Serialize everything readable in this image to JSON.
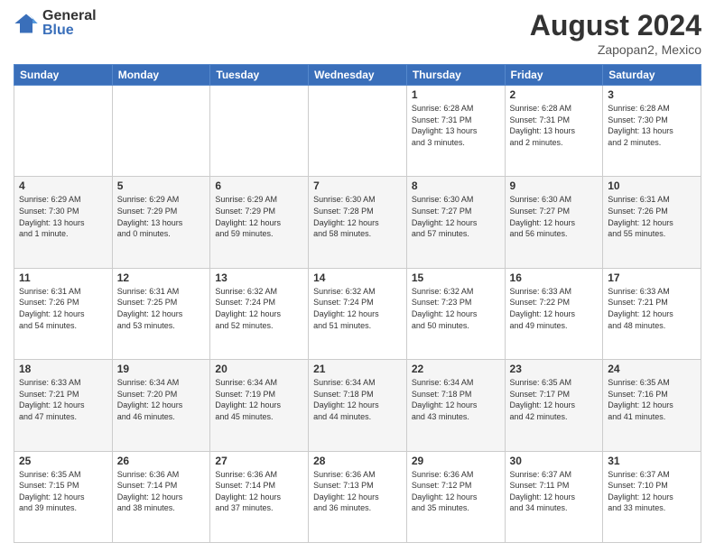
{
  "header": {
    "logo_general": "General",
    "logo_blue": "Blue",
    "month_year": "August 2024",
    "location": "Zapopan2, Mexico"
  },
  "days_of_week": [
    "Sunday",
    "Monday",
    "Tuesday",
    "Wednesday",
    "Thursday",
    "Friday",
    "Saturday"
  ],
  "weeks": [
    [
      {
        "day": "",
        "info": ""
      },
      {
        "day": "",
        "info": ""
      },
      {
        "day": "",
        "info": ""
      },
      {
        "day": "",
        "info": ""
      },
      {
        "day": "1",
        "info": "Sunrise: 6:28 AM\nSunset: 7:31 PM\nDaylight: 13 hours\nand 3 minutes."
      },
      {
        "day": "2",
        "info": "Sunrise: 6:28 AM\nSunset: 7:31 PM\nDaylight: 13 hours\nand 2 minutes."
      },
      {
        "day": "3",
        "info": "Sunrise: 6:28 AM\nSunset: 7:30 PM\nDaylight: 13 hours\nand 2 minutes."
      }
    ],
    [
      {
        "day": "4",
        "info": "Sunrise: 6:29 AM\nSunset: 7:30 PM\nDaylight: 13 hours\nand 1 minute."
      },
      {
        "day": "5",
        "info": "Sunrise: 6:29 AM\nSunset: 7:29 PM\nDaylight: 13 hours\nand 0 minutes."
      },
      {
        "day": "6",
        "info": "Sunrise: 6:29 AM\nSunset: 7:29 PM\nDaylight: 12 hours\nand 59 minutes."
      },
      {
        "day": "7",
        "info": "Sunrise: 6:30 AM\nSunset: 7:28 PM\nDaylight: 12 hours\nand 58 minutes."
      },
      {
        "day": "8",
        "info": "Sunrise: 6:30 AM\nSunset: 7:27 PM\nDaylight: 12 hours\nand 57 minutes."
      },
      {
        "day": "9",
        "info": "Sunrise: 6:30 AM\nSunset: 7:27 PM\nDaylight: 12 hours\nand 56 minutes."
      },
      {
        "day": "10",
        "info": "Sunrise: 6:31 AM\nSunset: 7:26 PM\nDaylight: 12 hours\nand 55 minutes."
      }
    ],
    [
      {
        "day": "11",
        "info": "Sunrise: 6:31 AM\nSunset: 7:26 PM\nDaylight: 12 hours\nand 54 minutes."
      },
      {
        "day": "12",
        "info": "Sunrise: 6:31 AM\nSunset: 7:25 PM\nDaylight: 12 hours\nand 53 minutes."
      },
      {
        "day": "13",
        "info": "Sunrise: 6:32 AM\nSunset: 7:24 PM\nDaylight: 12 hours\nand 52 minutes."
      },
      {
        "day": "14",
        "info": "Sunrise: 6:32 AM\nSunset: 7:24 PM\nDaylight: 12 hours\nand 51 minutes."
      },
      {
        "day": "15",
        "info": "Sunrise: 6:32 AM\nSunset: 7:23 PM\nDaylight: 12 hours\nand 50 minutes."
      },
      {
        "day": "16",
        "info": "Sunrise: 6:33 AM\nSunset: 7:22 PM\nDaylight: 12 hours\nand 49 minutes."
      },
      {
        "day": "17",
        "info": "Sunrise: 6:33 AM\nSunset: 7:21 PM\nDaylight: 12 hours\nand 48 minutes."
      }
    ],
    [
      {
        "day": "18",
        "info": "Sunrise: 6:33 AM\nSunset: 7:21 PM\nDaylight: 12 hours\nand 47 minutes."
      },
      {
        "day": "19",
        "info": "Sunrise: 6:34 AM\nSunset: 7:20 PM\nDaylight: 12 hours\nand 46 minutes."
      },
      {
        "day": "20",
        "info": "Sunrise: 6:34 AM\nSunset: 7:19 PM\nDaylight: 12 hours\nand 45 minutes."
      },
      {
        "day": "21",
        "info": "Sunrise: 6:34 AM\nSunset: 7:18 PM\nDaylight: 12 hours\nand 44 minutes."
      },
      {
        "day": "22",
        "info": "Sunrise: 6:34 AM\nSunset: 7:18 PM\nDaylight: 12 hours\nand 43 minutes."
      },
      {
        "day": "23",
        "info": "Sunrise: 6:35 AM\nSunset: 7:17 PM\nDaylight: 12 hours\nand 42 minutes."
      },
      {
        "day": "24",
        "info": "Sunrise: 6:35 AM\nSunset: 7:16 PM\nDaylight: 12 hours\nand 41 minutes."
      }
    ],
    [
      {
        "day": "25",
        "info": "Sunrise: 6:35 AM\nSunset: 7:15 PM\nDaylight: 12 hours\nand 39 minutes."
      },
      {
        "day": "26",
        "info": "Sunrise: 6:36 AM\nSunset: 7:14 PM\nDaylight: 12 hours\nand 38 minutes."
      },
      {
        "day": "27",
        "info": "Sunrise: 6:36 AM\nSunset: 7:14 PM\nDaylight: 12 hours\nand 37 minutes."
      },
      {
        "day": "28",
        "info": "Sunrise: 6:36 AM\nSunset: 7:13 PM\nDaylight: 12 hours\nand 36 minutes."
      },
      {
        "day": "29",
        "info": "Sunrise: 6:36 AM\nSunset: 7:12 PM\nDaylight: 12 hours\nand 35 minutes."
      },
      {
        "day": "30",
        "info": "Sunrise: 6:37 AM\nSunset: 7:11 PM\nDaylight: 12 hours\nand 34 minutes."
      },
      {
        "day": "31",
        "info": "Sunrise: 6:37 AM\nSunset: 7:10 PM\nDaylight: 12 hours\nand 33 minutes."
      }
    ]
  ]
}
